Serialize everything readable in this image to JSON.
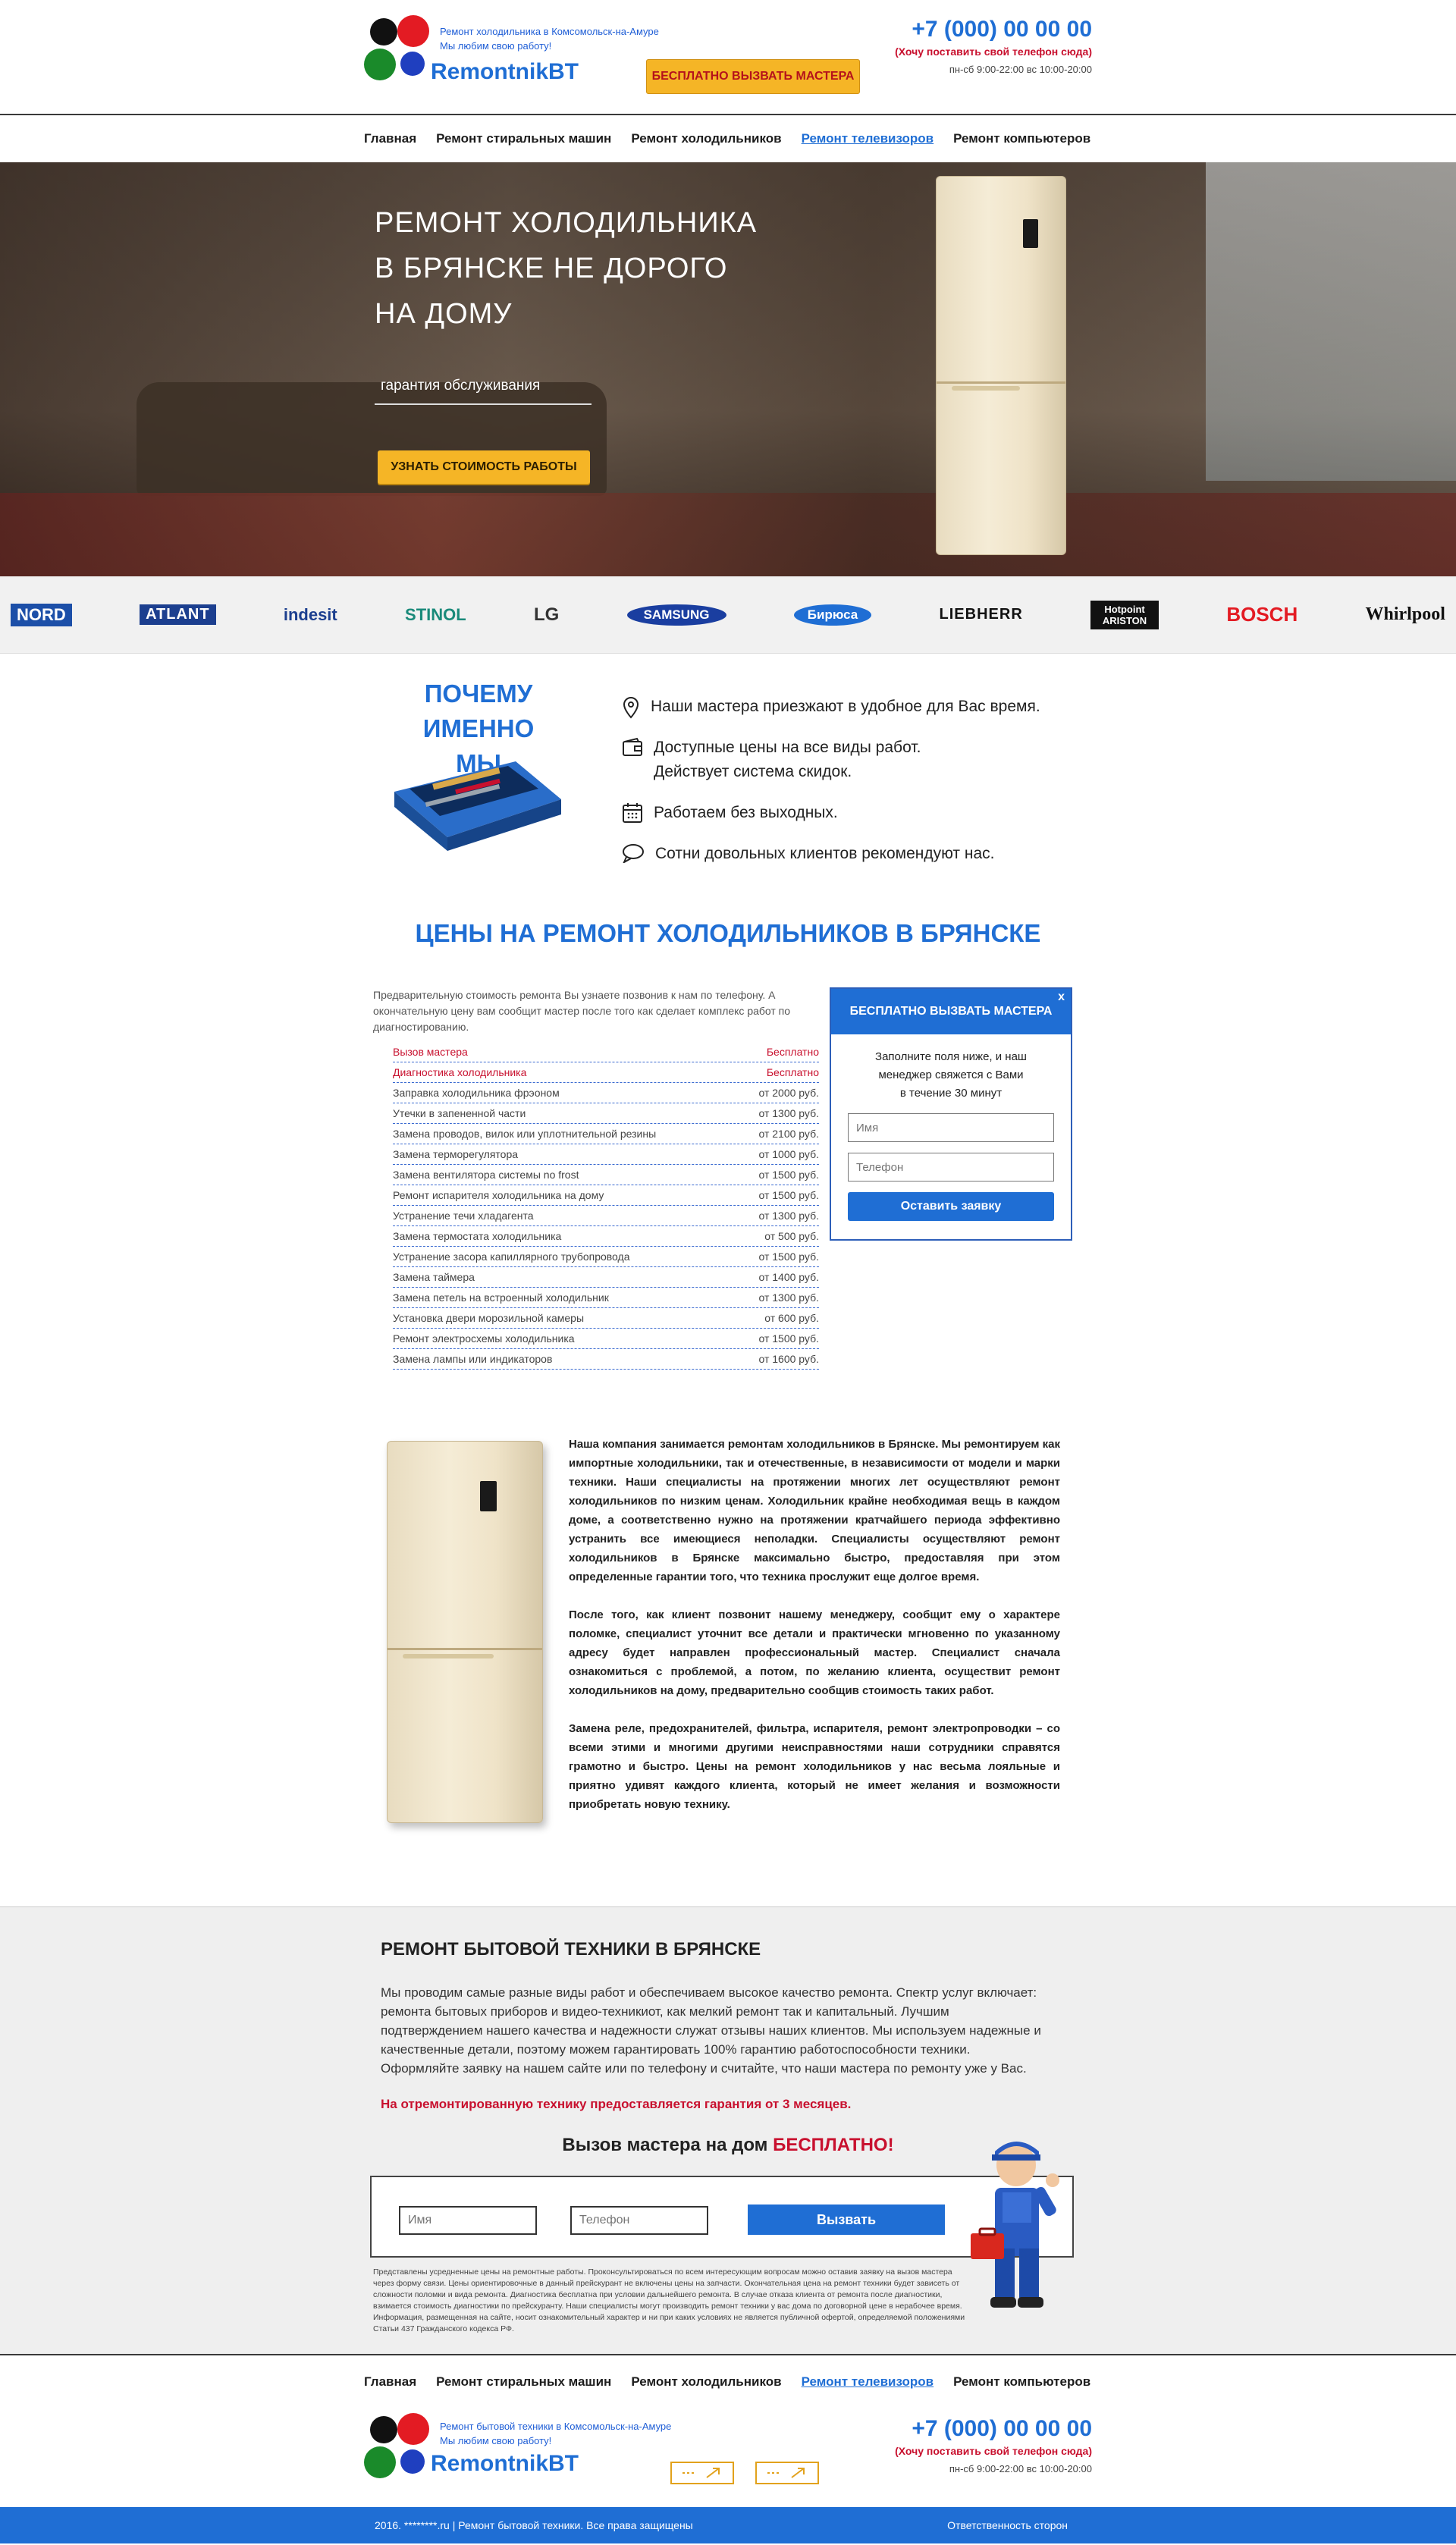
{
  "header": {
    "tagline_line1": "Ремонт холодильника в Комсомольск-на-Амуре",
    "tagline_line2": "Мы любим свою работу!",
    "logo_name": "RemontnikBT",
    "cta_label": "БЕСПЛАТНО ВЫЗВАТЬ МАСТЕРА",
    "phone": "+7 (000) 00 00 00",
    "phone_note": "(Хочу поставить свой телефон сюда)",
    "hours": "пн-сб 9:00-22:00 вс 10:00-20:00"
  },
  "nav": {
    "items": [
      "Главная",
      "Ремонт стиральных машин",
      "Ремонт холодильников",
      "Ремонт телевизоров",
      "Ремонт компьютеров"
    ],
    "active_index": 3
  },
  "hero": {
    "title_line1": "РЕМОНТ ХОЛОДИЛЬНИКА",
    "title_line2": "В БРЯНСКЕ НЕ ДОРОГО",
    "title_line3": "НА ДОМУ",
    "guarantee": "гарантия обслуживания",
    "button_label": "УЗНАТЬ СТОИМОСТЬ РАБОТЫ"
  },
  "brands": [
    "NORD",
    "ATLANT",
    "indesit",
    "STINOL",
    "LG",
    "SAMSUNG",
    "Бирюса",
    "LIEBHERR",
    "Hotpoint ARISTON",
    "BOSCH",
    "Whirlpool"
  ],
  "why": {
    "title_line1": "ПОЧЕМУ",
    "title_line2": "ИМЕННО МЫ",
    "items": [
      {
        "icon": "map-pin-icon",
        "text": "Наши мастера приезжают в удобное для Вас время."
      },
      {
        "icon": "wallet-icon",
        "text_line1": "Доступные цены на все виды работ.",
        "text_line2": "Действует система скидок."
      },
      {
        "icon": "calendar-icon",
        "text": "Работаем без выходных."
      },
      {
        "icon": "speech-bubble-icon",
        "text": "Сотни довольных клиентов рекомендуют нас."
      }
    ]
  },
  "prices": {
    "title": "ЦЕНЫ НА РЕМОНТ ХОЛОДИЛЬНИКОВ В БРЯНСКЕ",
    "intro": "Предварительную стоимость ремонта Вы узнаете позвонив к нам по телефону. А окончательную цену вам сообщит мастер после того как сделает комплекс работ по диагностированию.",
    "rows": [
      {
        "name": "Вызов мастера",
        "price": "Бесплатно",
        "highlight": true
      },
      {
        "name": "Диагностика холодильника",
        "price": "Бесплатно",
        "highlight": true
      },
      {
        "name": "Заправка холодильника фрэоном",
        "price": "от 2000 руб."
      },
      {
        "name": "Утечки в запененной части",
        "price": "от 1300 руб."
      },
      {
        "name": "Замена проводов, вилок или уплотнительной резины",
        "price": "от 2100 руб."
      },
      {
        "name": "Замена терморегулятора",
        "price": "от 1000 руб."
      },
      {
        "name": "Замена вентилятора системы no frost",
        "price": "от 1500 руб."
      },
      {
        "name": "Ремонт испарителя холодильника на дому",
        "price": "от 1500 руб."
      },
      {
        "name": "Устранение течи хладагента",
        "price": "от 1300 руб."
      },
      {
        "name": "Замена термостата холодильника",
        "price": "от 500 руб."
      },
      {
        "name": "Устранение засора капиллярного трубопровода",
        "price": "от 1500 руб."
      },
      {
        "name": "Замена таймера",
        "price": "от 1400 руб."
      },
      {
        "name": "Замена петель на встроенный холодильник",
        "price": "от 1300 руб."
      },
      {
        "name": "Установка двери морозильной камеры",
        "price": "от 600 руб."
      },
      {
        "name": "Ремонт электросхемы холодильника",
        "price": "от 1500 руб."
      },
      {
        "name": "Замена лампы или индикаторов",
        "price": "от 1600 руб."
      }
    ]
  },
  "popup": {
    "title": "БЕСПЛАТНО ВЫЗВАТЬ МАСТЕРА",
    "close": "x",
    "text_line1": "Заполните поля ниже, и наш",
    "text_line2": "менеджер свяжется с Вами",
    "text_line3": "в течение 30 минут",
    "name_placeholder": "Имя",
    "phone_placeholder": "Телефон",
    "submit_label": "Оставить заявку"
  },
  "about": {
    "p1": "Наша компания занимается ремонтам холодильников в Брянске. Мы ремонтируем как импортные холодильники, так и отечественные, в независимости от модели и марки техники. Наши специалисты на протяжении многих лет осуществляют ремонт холодильников по низким ценам. Холодильник крайне необходимая вещь в каждом доме, а соответственно нужно на протяжении кратчайшего периода эффективно устранить все имеющиеся неполадки. Специалисты осуществляют ремонт холодильников в Брянске максимально быстро, предоставляя при этом определенные гарантии того, что техника прослужит еще долгое время.",
    "p2": "После того, как клиент позвонит нашему менеджеру, сообщит ему о характере поломке, специалист уточнит все детали и практически мгновенно по указанному адресу будет направлен профессиональный мастер. Специалист сначала ознакомиться с проблемой, а потом, по желанию клиента, осуществит ремонт холодильников на дому, предварительно сообщив стоимость таких работ.",
    "p3": "Замена реле, предохранителей, фильтра, испарителя, ремонт электропроводки – со всеми этими и многими другими неисправностями наши сотрудники справятся грамотно и быстро. Цены на ремонт холодильников у нас весьма лояльные и приятно удивят каждого клиента, который не имеет желания и возможности приобретать новую технику."
  },
  "service": {
    "title": "РЕМОНТ БЫТОВОЙ ТЕХНИКИ В БРЯНСКЕ",
    "text": "Мы проводим самые разные виды работ и обеспечиваем высокое качество ремонта. Спектр услуг включает: ремонта бытовых приборов и видео-техникиот, как мелкий ремонт так и капитальный. Лучшим подтверждением нашего качества и надежности служат отзывы наших клиентов. Мы используем надежные и качественные детали, поэтому можем гарантировать 100% гарантию работоспособности техники. Оформляйте заявку на нашем сайте или по телефону и считайте, что наши мастера по ремонту уже у Вас.",
    "warranty": "На отремонтированную технику предоставляется гарантия от 3 месяцев.",
    "callout_prefix": "Вызов мастера на дом",
    "callout_free": "БЕСПЛАТНО!",
    "name_placeholder": "Имя",
    "phone_placeholder": "Телефон",
    "submit_label": "Вызвать",
    "disclaimer": "Представлены усредненные цены на ремонтные работы. Проконсультироваться по всем интересующим вопросам можно оставив заявку на вызов мастера через форму связи. Цены ориентировочные в данный прейскурант не включены цены на запчасти. Окончательная цена на ремонт техники будет зависеть от сложности поломки и вида ремонта. Диагностика бесплатна при условии дальнейшего ремонта. В случае отказа клиента от ремонта после диагностики, взимается стоимость диагностики по прейскуранту. Наши специалисты могут производить ремонт техники у вас дома по договорной цене в нерабочее время. Информация, размещенная на сайте, носит ознакомительный характер и ни при каких условиях не является публичной офертой, определяемой положениями Статьи 437 Гражданского кодекса РФ."
  },
  "footer": {
    "tagline_line1": "Ремонт бытовой техники в Комсомольск-на-Амуре",
    "tagline_line2": "Мы любим свою работу!",
    "logo_name": "RemontnikBT",
    "phone": "+7 (000) 00 00 00",
    "phone_note": "(Хочу поставить свой телефон сюда)",
    "hours": "пн-сб 9:00-22:00 вс 10:00-20:00",
    "copyright": "2016. ********.ru | Ремонт бытовой техники. Все права защищены",
    "responsibility": "Ответственность сторон"
  },
  "colors": {
    "accent_blue": "#1f6ed4",
    "button_yellow": "#f5b526",
    "alert_red": "#c8102e"
  }
}
